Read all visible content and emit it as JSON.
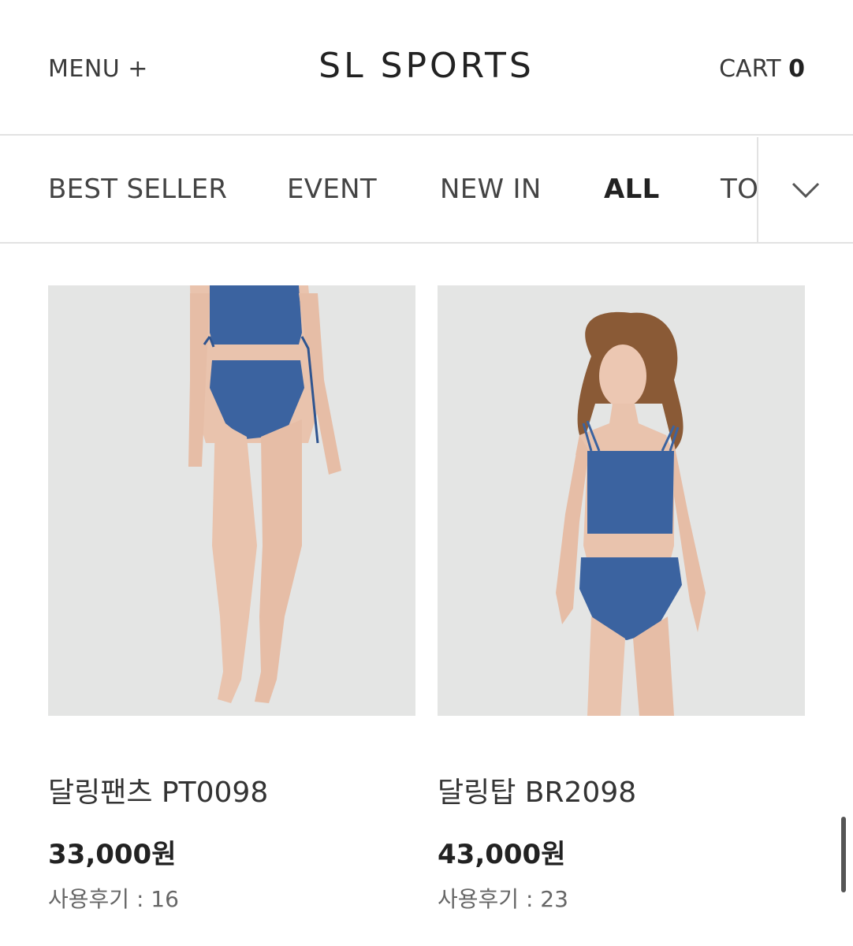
{
  "header": {
    "menu_label": "MENU +",
    "logo": "SL SPORTS",
    "cart_label": "CART",
    "cart_count": "0"
  },
  "categories": [
    {
      "label": "BEST SELLER",
      "active": false
    },
    {
      "label": "EVENT",
      "active": false
    },
    {
      "label": "NEW IN",
      "active": false
    },
    {
      "label": "ALL",
      "active": true
    },
    {
      "label": "TO",
      "active": false
    }
  ],
  "products": [
    {
      "name": "달링팬츠 PT0098",
      "price": "33,000원",
      "reviews_label": "사용후기 : 16"
    },
    {
      "name": "달링탑 BR2098",
      "price": "43,000원",
      "reviews_label": "사용후기 : 23"
    }
  ],
  "colors": {
    "swimwear": "#3b63a0",
    "photo_bg": "#e4e5e4",
    "skin": "#e9c3ad"
  }
}
